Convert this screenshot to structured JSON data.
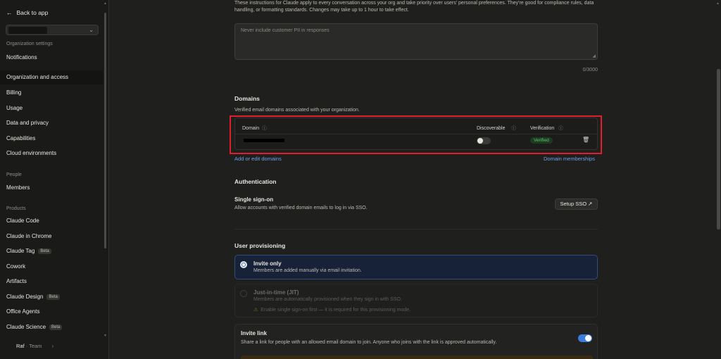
{
  "sidebar": {
    "back_label": "Back to app",
    "section_org": "Organization settings",
    "items_top": [
      "Notifications",
      "Organization and access",
      "Billing",
      "Usage",
      "Data and privacy",
      "Capabilities",
      "Cloud environments"
    ],
    "section_people": "People",
    "members": "Members",
    "section_products": "Products",
    "products": [
      {
        "label": "Claude Code",
        "beta": ""
      },
      {
        "label": "Claude in Chrome",
        "beta": ""
      },
      {
        "label": "Claude Tag",
        "beta": "Beta"
      },
      {
        "label": "Cowork",
        "beta": ""
      },
      {
        "label": "Artifacts",
        "beta": ""
      },
      {
        "label": "Claude Design",
        "beta": "Beta"
      },
      {
        "label": "Office Agents",
        "beta": ""
      },
      {
        "label": "Claude Science",
        "beta": "Beta"
      }
    ],
    "footer_user": "Raf",
    "footer_sep": "·",
    "footer_plan": "Team",
    "footer_chevron": "›"
  },
  "instructions": {
    "intro": "These instructions for Claude apply to every conversation across your org and take priority over users' personal preferences. They're good for compliance rules, data handling, or formatting standards. Changes may take up to 1 hour to take effect.",
    "placeholder": "Never include customer PII in responses",
    "counter": "0/3000"
  },
  "domains": {
    "title": "Domains",
    "description": "Verified email domains associated with your organization.",
    "col_domain": "Domain",
    "col_discoverable": "Discoverable",
    "col_verification": "Verification",
    "status": "Verified",
    "add_link": "Add or edit domains",
    "memberships_link": "Domain memberships"
  },
  "authentication": {
    "title": "Authentication",
    "sso_title": "Single sign-on",
    "sso_desc": "Allow accounts with verified domain emails to log in via SSO.",
    "sso_button": "Setup SSO"
  },
  "provisioning": {
    "title": "User provisioning",
    "invite_only_title": "Invite only",
    "invite_only_desc": "Members are added manually via email invitation.",
    "jit_title": "Just-in-time (JIT)",
    "jit_desc": "Members are automatically provisioned when they sign in with SSO.",
    "jit_warning": "Enable single sign-on first — it is required for this provisioning mode."
  },
  "invite_link": {
    "title": "Invite link",
    "desc": "Share a link for people with an allowed email domain to join. Anyone who joins with the link is approved automatically."
  },
  "icons": {
    "back": "←",
    "chevron_down": "⌄",
    "info": "ⓘ",
    "trash": "🗑",
    "external": "↗",
    "warning": "⚠",
    "resize": "◢"
  },
  "colors": {
    "accent": "#3b7ddd",
    "link": "#6fa0e8",
    "verified": "#5cc46a",
    "highlight": "#e01e2d"
  }
}
